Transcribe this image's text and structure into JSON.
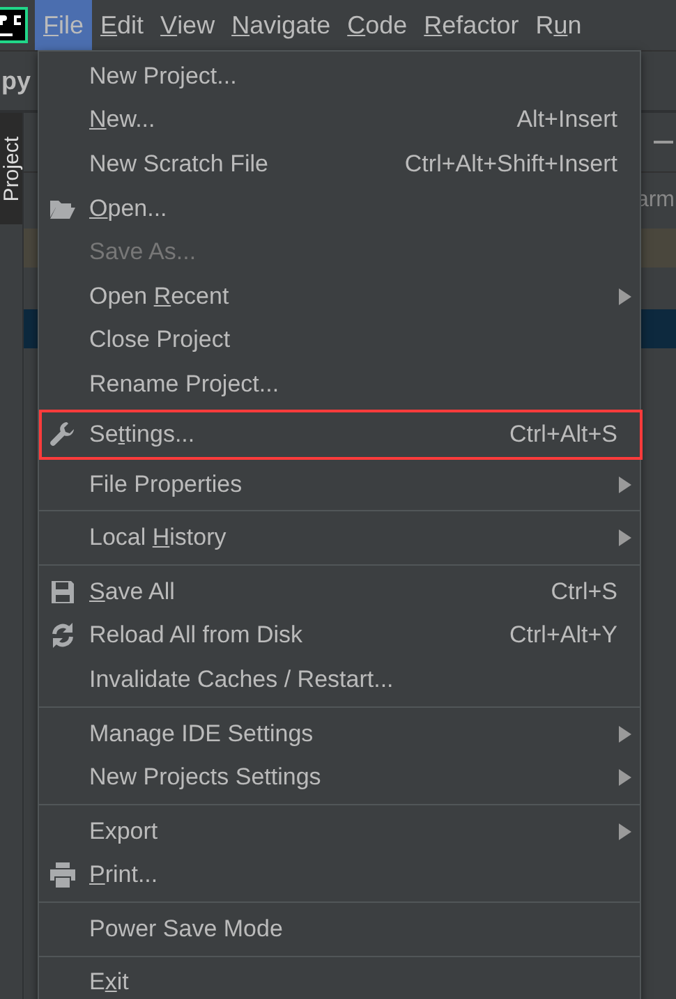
{
  "menu_bar": {
    "items": [
      {
        "key": "F",
        "post": "ile",
        "selected": true
      },
      {
        "key": "E",
        "post": "dit",
        "selected": false
      },
      {
        "key": "V",
        "post": "iew",
        "selected": false
      },
      {
        "key": "N",
        "post": "avigate",
        "selected": false
      },
      {
        "key": "C",
        "post": "ode",
        "selected": false
      },
      {
        "key": "R",
        "post": "efactor",
        "selected": false
      },
      {
        "pre": "R",
        "key": "u",
        "post": "n",
        "selected": false
      }
    ]
  },
  "background": {
    "project_name": "py",
    "tool_tab": "Project",
    "side_text": "arm"
  },
  "menu": {
    "groups": [
      [
        {
          "kind": "plain",
          "label": "New Project..."
        },
        {
          "kind": "plain",
          "key": "N",
          "post": "ew...",
          "shortcut": "Alt+Insert"
        },
        {
          "kind": "plain",
          "label": "New Scratch File",
          "shortcut": "Ctrl+Alt+Shift+Insert"
        },
        {
          "kind": "folder",
          "key": "O",
          "post": "pen..."
        },
        {
          "kind": "plain",
          "label": "Save As...",
          "disabled": true
        },
        {
          "kind": "plain",
          "pre": "Open ",
          "key": "R",
          "post": "ecent",
          "submenu": true
        },
        {
          "kind": "plain",
          "label": "Close Project"
        },
        {
          "kind": "plain",
          "label": "Rename Project..."
        },
        {
          "kind": "wrench",
          "pre": "Se",
          "key": "t",
          "post": "tings...",
          "shortcut": "Ctrl+Alt+S",
          "highlighted": true
        },
        {
          "kind": "plain",
          "label": "File Properties",
          "submenu": true
        }
      ],
      [
        {
          "kind": "plain",
          "pre": "Local ",
          "key": "H",
          "post": "istory",
          "submenu": true
        }
      ],
      [
        {
          "kind": "save",
          "key": "S",
          "post": "ave All",
          "shortcut": "Ctrl+S"
        },
        {
          "kind": "reload",
          "label": "Reload All from Disk",
          "shortcut": "Ctrl+Alt+Y"
        },
        {
          "kind": "plain",
          "label": "Invalidate Caches / Restart..."
        }
      ],
      [
        {
          "kind": "plain",
          "label": "Manage IDE Settings",
          "submenu": true
        },
        {
          "kind": "plain",
          "label": "New Projects Settings",
          "submenu": true
        }
      ],
      [
        {
          "kind": "plain",
          "label": "Export",
          "submenu": true
        },
        {
          "kind": "printer",
          "key": "P",
          "post": "rint..."
        }
      ],
      [
        {
          "kind": "plain",
          "label": "Power Save Mode"
        }
      ],
      [
        {
          "kind": "plain",
          "pre": "E",
          "key": "x",
          "post": "it"
        }
      ]
    ]
  }
}
